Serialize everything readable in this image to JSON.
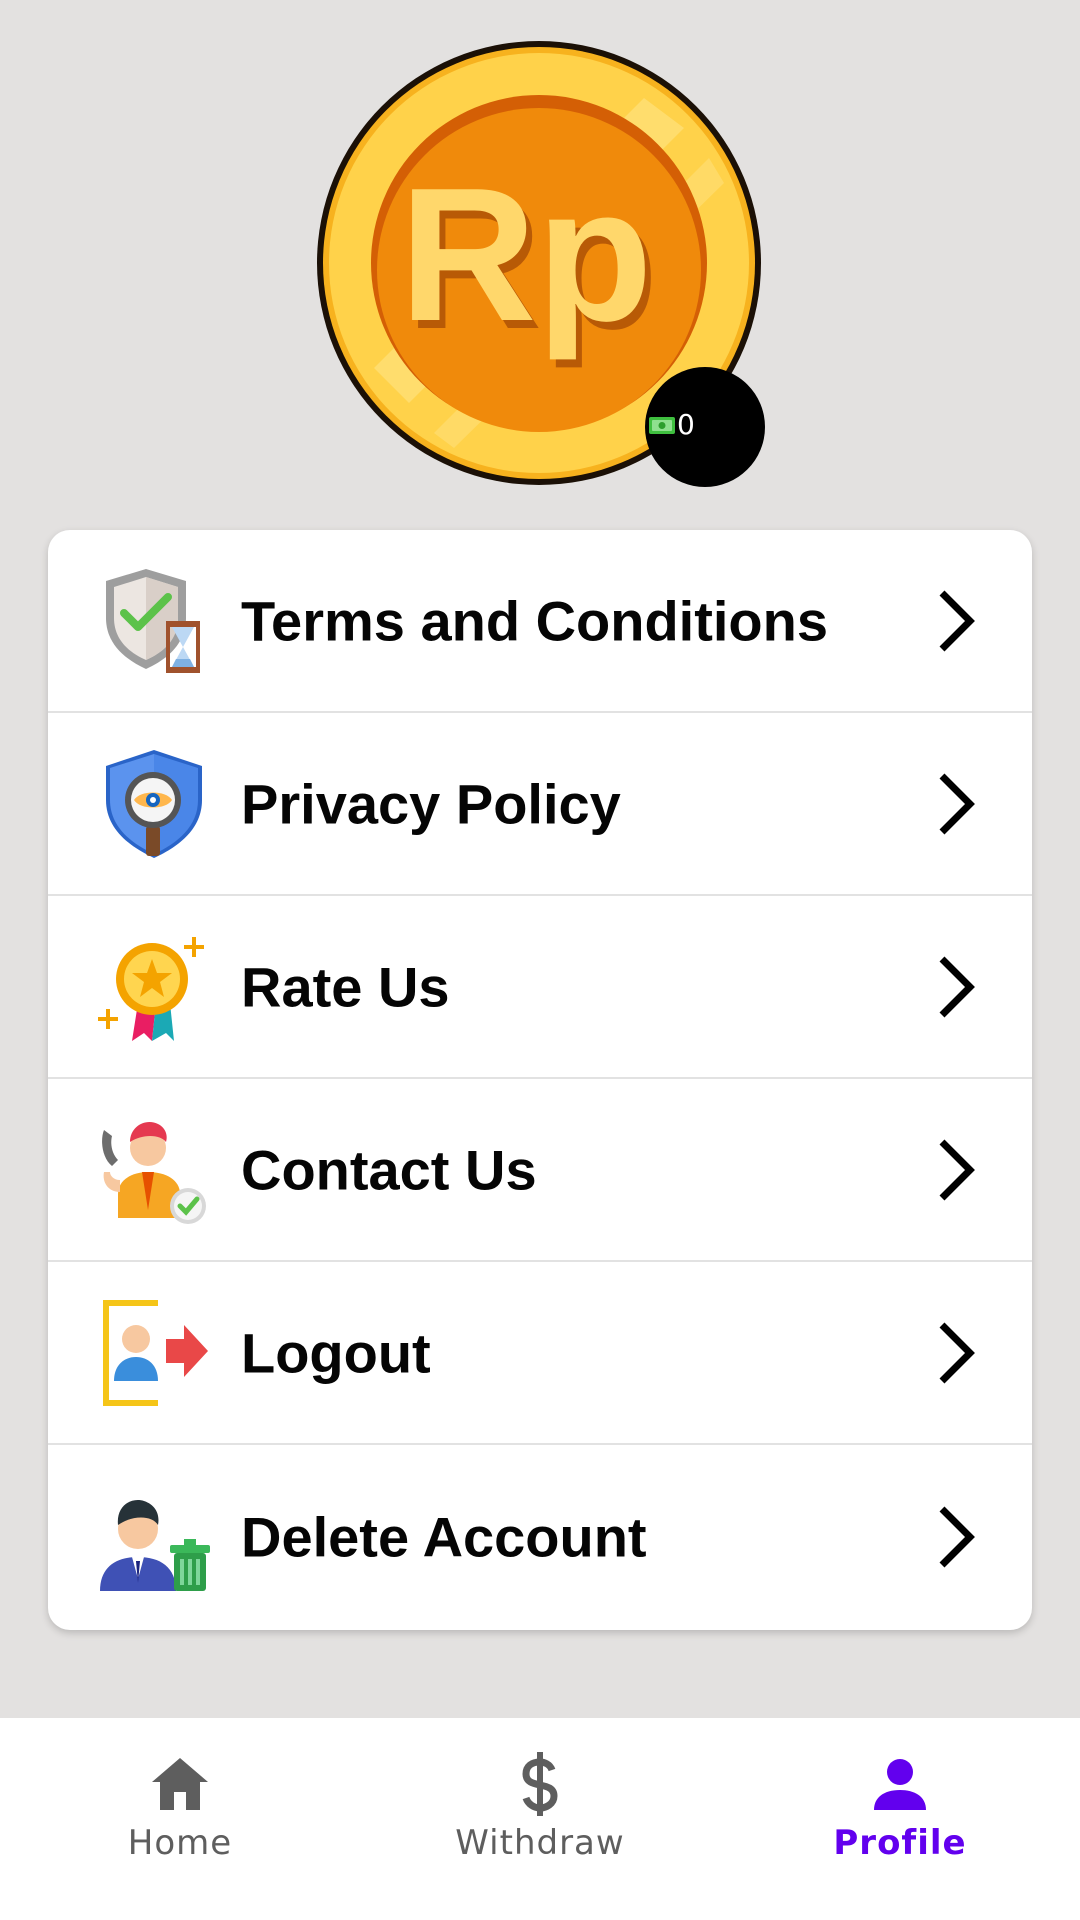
{
  "avatar": {
    "coin_letters": "Rp",
    "balance": "0",
    "balance_icon": "cash-icon"
  },
  "menu": [
    {
      "label": "Terms and Conditions",
      "icon": "shield-hourglass-icon"
    },
    {
      "label": "Privacy Policy",
      "icon": "privacy-shield-icon"
    },
    {
      "label": "Rate Us",
      "icon": "award-medal-icon"
    },
    {
      "label": "Contact Us",
      "icon": "support-agent-icon"
    },
    {
      "label": "Logout",
      "icon": "logout-icon"
    },
    {
      "label": "Delete Account",
      "icon": "delete-user-icon"
    }
  ],
  "bottom_nav": {
    "items": [
      {
        "label": "Home",
        "icon": "home-icon",
        "active": false
      },
      {
        "label": "Withdraw",
        "icon": "dollar-icon",
        "active": false
      },
      {
        "label": "Profile",
        "icon": "person-icon",
        "active": true
      }
    ]
  },
  "colors": {
    "background": "#e3e1e0",
    "accent": "#6200ee",
    "inactive_nav": "#5e5e5e",
    "coin_outer": "#fbc02d",
    "coin_inner": "#f08a0b"
  }
}
